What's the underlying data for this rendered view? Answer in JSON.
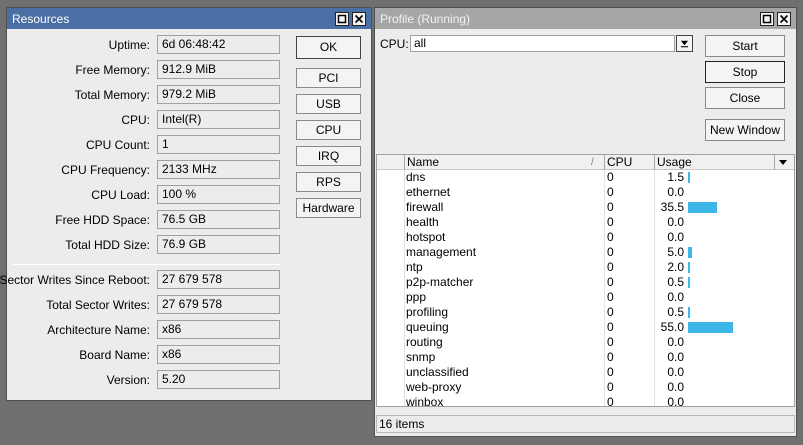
{
  "resources": {
    "title": "Resources",
    "fields": [
      {
        "label": "Uptime:",
        "value": "6d 06:48:42"
      },
      {
        "label": "Free Memory:",
        "value": "912.9 MiB"
      },
      {
        "label": "Total Memory:",
        "value": "979.2 MiB"
      },
      {
        "label": "CPU:",
        "value": "Intel(R)"
      },
      {
        "label": "CPU Count:",
        "value": "1"
      },
      {
        "label": "CPU Frequency:",
        "value": "2133 MHz"
      },
      {
        "label": "CPU Load:",
        "value": "100 %"
      },
      {
        "label": "Free HDD Space:",
        "value": "76.5 GB"
      },
      {
        "label": "Total HDD Size:",
        "value": "76.9 GB"
      },
      {
        "label": "Sector Writes Since Reboot:",
        "value": "27 679 578"
      },
      {
        "label": "Total Sector Writes:",
        "value": "27 679 578"
      },
      {
        "label": "Architecture Name:",
        "value": "x86"
      },
      {
        "label": "Board Name:",
        "value": "x86"
      },
      {
        "label": "Version:",
        "value": "5.20"
      }
    ],
    "buttons": {
      "ok": "OK",
      "pci": "PCI",
      "usb": "USB",
      "cpu": "CPU",
      "irq": "IRQ",
      "rps": "RPS",
      "hardware": "Hardware"
    }
  },
  "profile": {
    "title": "Profile (Running)",
    "cpu_label": "CPU:",
    "cpu_selected": "all",
    "buttons": {
      "start": "Start",
      "stop": "Stop",
      "close": "Close",
      "new_window": "New Window"
    },
    "columns": {
      "name": "Name",
      "cpu": "CPU",
      "usage": "Usage"
    },
    "rows": [
      {
        "name": "dns",
        "cpu": "0",
        "usage": "1.5",
        "usage_value": 1.5
      },
      {
        "name": "ethernet",
        "cpu": "0",
        "usage": "0.0",
        "usage_value": 0.0
      },
      {
        "name": "firewall",
        "cpu": "0",
        "usage": "35.5",
        "usage_value": 35.5
      },
      {
        "name": "health",
        "cpu": "0",
        "usage": "0.0",
        "usage_value": 0.0
      },
      {
        "name": "hotspot",
        "cpu": "0",
        "usage": "0.0",
        "usage_value": 0.0
      },
      {
        "name": "management",
        "cpu": "0",
        "usage": "5.0",
        "usage_value": 5.0
      },
      {
        "name": "ntp",
        "cpu": "0",
        "usage": "2.0",
        "usage_value": 2.0
      },
      {
        "name": "p2p-matcher",
        "cpu": "0",
        "usage": "0.5",
        "usage_value": 0.5
      },
      {
        "name": "ppp",
        "cpu": "0",
        "usage": "0.0",
        "usage_value": 0.0
      },
      {
        "name": "profiling",
        "cpu": "0",
        "usage": "0.5",
        "usage_value": 0.5
      },
      {
        "name": "queuing",
        "cpu": "0",
        "usage": "55.0",
        "usage_value": 55.0
      },
      {
        "name": "routing",
        "cpu": "0",
        "usage": "0.0",
        "usage_value": 0.0
      },
      {
        "name": "snmp",
        "cpu": "0",
        "usage": "0.0",
        "usage_value": 0.0
      },
      {
        "name": "unclassified",
        "cpu": "0",
        "usage": "0.0",
        "usage_value": 0.0
      },
      {
        "name": "web-proxy",
        "cpu": "0",
        "usage": "0.0",
        "usage_value": 0.0
      },
      {
        "name": "winbox",
        "cpu": "0",
        "usage": "0.0",
        "usage_value": 0.0
      }
    ],
    "status": "16 items"
  },
  "colors": {
    "active_titlebar": "#4a6fa5",
    "inactive_titlebar": "#a6a6a6",
    "usage_bar": "#3fb6ea",
    "desktop": "#6f6f6f"
  },
  "icons": {
    "restore": "restore-icon",
    "close": "close-icon",
    "dropdown": "dropdown-arrow-icon",
    "sort": "sort-icon",
    "column_menu": "column-menu-icon"
  }
}
